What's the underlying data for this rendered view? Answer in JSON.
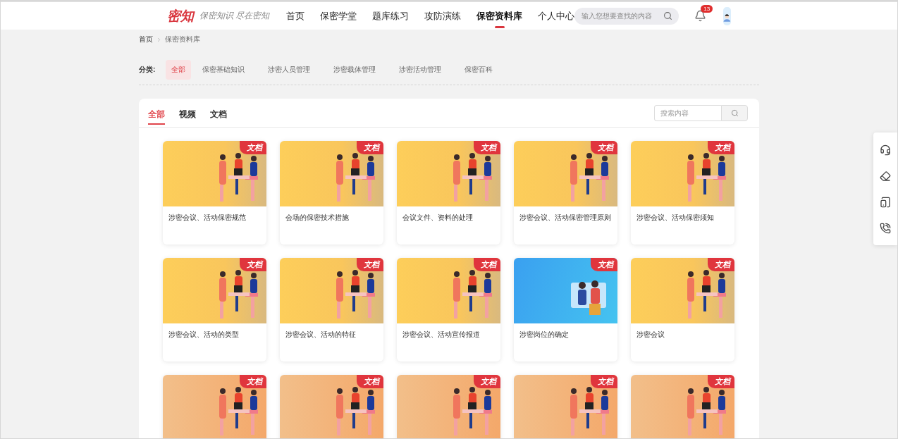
{
  "header": {
    "logo": "密知",
    "slogan": "保密知识 尽在密知",
    "nav": [
      {
        "label": "首页",
        "selected": false
      },
      {
        "label": "保密学堂",
        "selected": false
      },
      {
        "label": "题库练习",
        "selected": false
      },
      {
        "label": "攻防演练",
        "selected": false
      },
      {
        "label": "保密资料库",
        "selected": true
      },
      {
        "label": "个人中心",
        "selected": false
      }
    ],
    "search": {
      "placeholder": "输入您想要查找的内容"
    },
    "notifications": "13"
  },
  "breadcrumb": [
    "首页",
    "保密资料库"
  ],
  "categories": {
    "label": "分类:",
    "items": [
      {
        "label": "全部",
        "selected": true
      },
      {
        "label": "保密基础知识",
        "selected": false
      },
      {
        "label": "涉密人员管理",
        "selected": false
      },
      {
        "label": "涉密载体管理",
        "selected": false
      },
      {
        "label": "涉密活动管理",
        "selected": false
      },
      {
        "label": "保密百科",
        "selected": false
      }
    ]
  },
  "panel": {
    "tabs": [
      {
        "label": "全部",
        "selected": true
      },
      {
        "label": "视频",
        "selected": false
      },
      {
        "label": "文档",
        "selected": false
      }
    ],
    "search": {
      "placeholder": "搜索内容"
    },
    "cards": [
      {
        "kind": "yellow",
        "badge": "文档",
        "title": "涉密会议、活动保密规范"
      },
      {
        "kind": "yellow",
        "badge": "文档",
        "title": "会场的保密技术措施"
      },
      {
        "kind": "yellow",
        "badge": "文档",
        "title": "会议文件、资料的处理"
      },
      {
        "kind": "yellow",
        "badge": "文档",
        "title": "涉密会议、活动保密管理原则"
      },
      {
        "kind": "yellow",
        "badge": "文档",
        "title": "涉密会议、活动保密须知"
      },
      {
        "kind": "yellow",
        "badge": "文档",
        "title": "涉密会议、活动的类型"
      },
      {
        "kind": "yellow",
        "badge": "文档",
        "title": "涉密会议、活动的特征"
      },
      {
        "kind": "yellow",
        "badge": "文档",
        "title": "涉密会议、活动宣传报道"
      },
      {
        "kind": "blue",
        "badge": "文档",
        "title": "涉密岗位的确定"
      },
      {
        "kind": "yellow",
        "badge": "文档",
        "title": "涉密会议"
      },
      {
        "kind": "orange",
        "badge": "文档"
      },
      {
        "kind": "orange",
        "badge": "文档"
      },
      {
        "kind": "orange",
        "badge": "文档"
      },
      {
        "kind": "orange",
        "badge": "文档"
      },
      {
        "kind": "orange",
        "badge": "文档"
      }
    ]
  }
}
